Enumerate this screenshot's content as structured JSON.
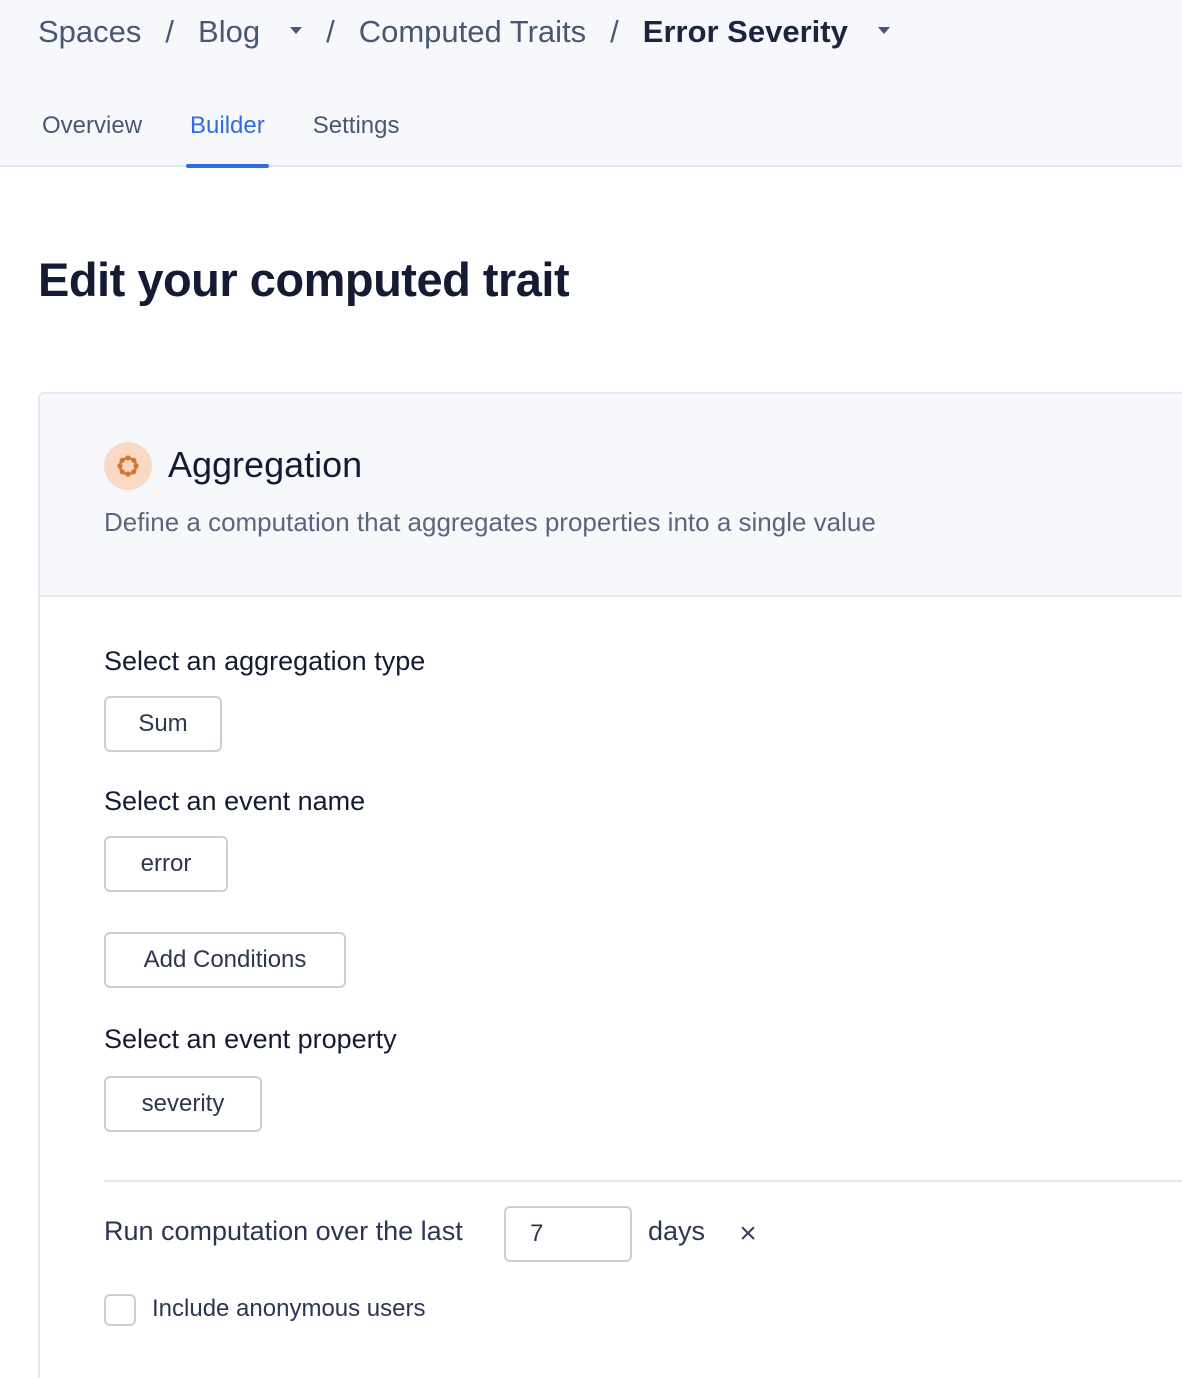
{
  "breadcrumb": {
    "spaces": "Spaces",
    "separator": "/",
    "blog": "Blog",
    "computed_traits": "Computed Traits",
    "current": "Error Severity"
  },
  "tabs": [
    {
      "label": "Overview",
      "active": false
    },
    {
      "label": "Builder",
      "active": true
    },
    {
      "label": "Settings",
      "active": false
    }
  ],
  "page_title": "Edit your computed trait",
  "card": {
    "icon": "aggregation-icon",
    "title": "Aggregation",
    "description": "Define a computation that aggregates properties into a single value"
  },
  "form": {
    "aggregation_type_label": "Select an aggregation type",
    "aggregation_type_value": "Sum",
    "event_name_label": "Select an event name",
    "event_name_value": "error",
    "add_conditions_label": "Add Conditions",
    "event_property_label": "Select an event property",
    "event_property_value": "severity"
  },
  "time_window": {
    "prefix": "Run computation over the last",
    "value": "7",
    "suffix": "days",
    "remove_symbol": "×"
  },
  "anonymous": {
    "label": "Include anonymous users",
    "checked": false
  },
  "colors": {
    "accent": "#2f6be6",
    "icon_bg": "#f9d9c3",
    "icon_fg": "#d9742e"
  }
}
